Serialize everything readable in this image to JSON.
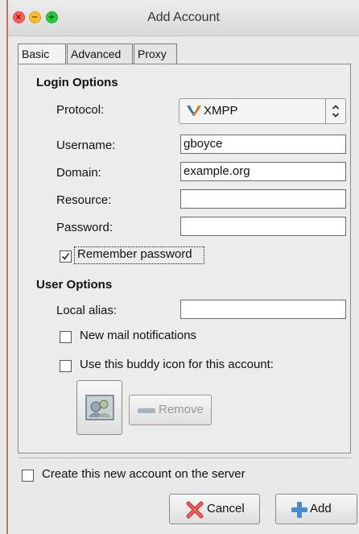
{
  "window": {
    "title": "Add Account"
  },
  "tabs": [
    {
      "label": "Basic",
      "active": true
    },
    {
      "label": "Advanced",
      "active": false
    },
    {
      "label": "Proxy",
      "active": false
    }
  ],
  "login_options": {
    "heading": "Login Options",
    "protocol": {
      "label": "Protocol:",
      "value": "XMPP",
      "icon": "xmpp-icon"
    },
    "username": {
      "label": "Username:",
      "value": "gboyce"
    },
    "domain": {
      "label": "Domain:",
      "value": "example.org"
    },
    "resource": {
      "label": "Resource:",
      "value": ""
    },
    "password": {
      "label": "Password:",
      "value": ""
    },
    "remember_password": {
      "label": "Remember password",
      "checked": true
    }
  },
  "user_options": {
    "heading": "User Options",
    "local_alias": {
      "label": "Local alias:",
      "value": ""
    },
    "new_mail": {
      "label": "New mail notifications",
      "checked": false
    },
    "buddy_icon": {
      "label": "Use this buddy icon for this account:",
      "checked": false
    },
    "remove_label": "Remove"
  },
  "create_account": {
    "label": "Create this new account on the server",
    "checked": false
  },
  "buttons": {
    "cancel": "Cancel",
    "add": "Add"
  },
  "colors": {
    "close": "#fc5f57",
    "minimize": "#fdbb2e",
    "maximize": "#28c83f",
    "window_bg": "#e9e9e9"
  }
}
